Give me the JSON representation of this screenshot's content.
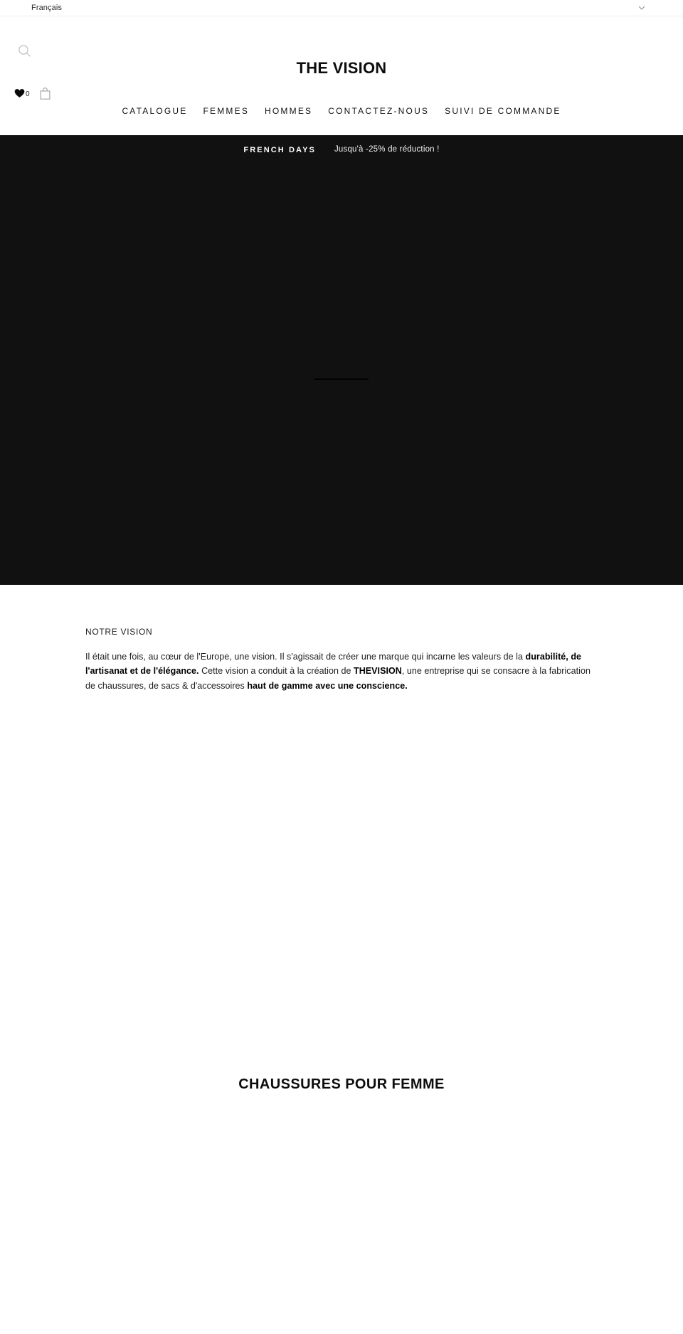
{
  "language_bar": {
    "selected_language": "Français",
    "chevron_icon": "chevron-down-icon"
  },
  "header": {
    "search_icon": "search-icon",
    "brand_title": "THE VISION",
    "wishlist": {
      "icon": "heart-icon",
      "count": "0"
    },
    "cart": {
      "icon": "shopping-bag-icon"
    },
    "nav": [
      {
        "label": "CATALOGUE"
      },
      {
        "label": "FEMMES"
      },
      {
        "label": "HOMMES"
      },
      {
        "label": "CONTACTEZ-NOUS"
      },
      {
        "label": "SUIVI DE COMMANDE"
      }
    ]
  },
  "announcement": {
    "headline": "FRENCH DAYS",
    "message": "Jusqu'à -25% de réduction !",
    "background_color": "#111111",
    "text_color": "#ffffff"
  },
  "hero": {
    "background_color": "#111111"
  },
  "vision": {
    "eyebrow": "NOTRE VISION",
    "paragraph_part_1": "Il était une fois, au cœur de l'Europe, une vision. Il s'agissait de créer une marque qui incarne les valeurs de la ",
    "paragraph_bold_1": "durabilité, de l'artisanat et de l'élégance.",
    "paragraph_part_2": " Cette vision a conduit à la création de ",
    "paragraph_bold_2": "THEVISION",
    "paragraph_part_3": ", une entreprise qui se consacre à la fabrication de chaussures, de sacs & d'accessoires ",
    "paragraph_bold_3": "haut de gamme avec une conscience."
  },
  "products": {
    "section_title": "CHAUSSURES POUR FEMME"
  }
}
